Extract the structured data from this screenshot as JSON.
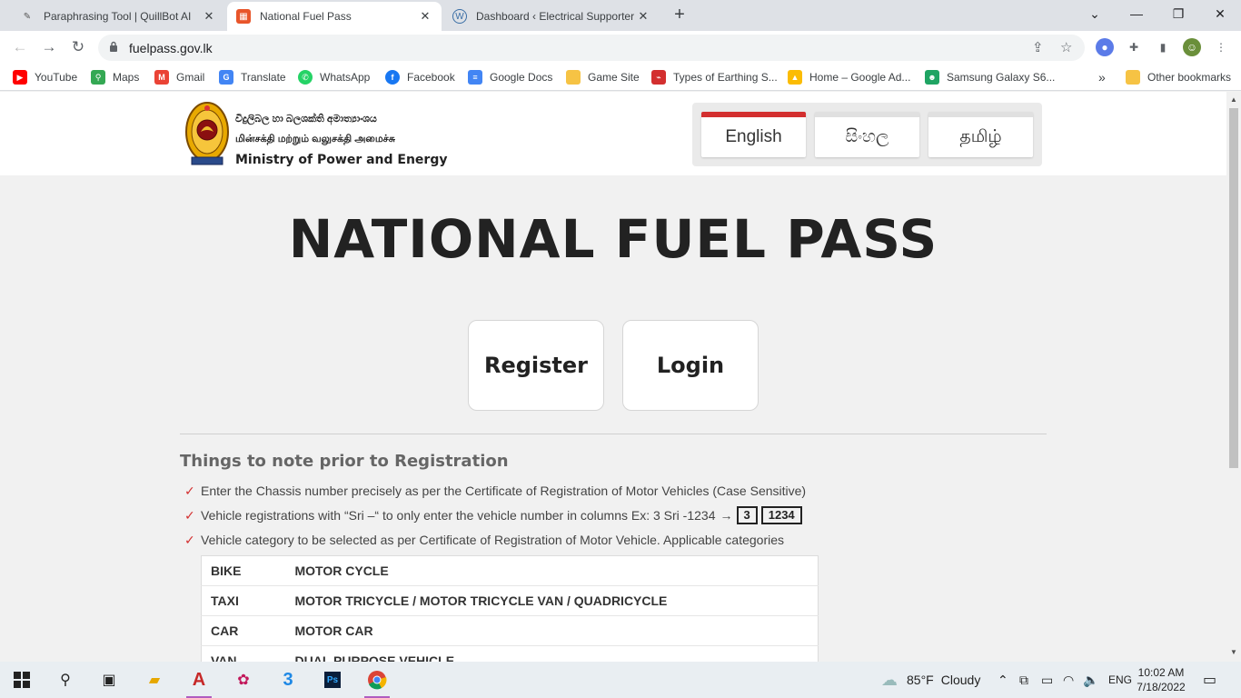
{
  "browser": {
    "tabs": [
      {
        "title": "Paraphrasing Tool | QuillBot AI",
        "icon": "quillbot-icon",
        "active": false
      },
      {
        "title": "National Fuel Pass",
        "icon": "fuelpass-icon",
        "active": true
      },
      {
        "title": "Dashboard ‹ Electrical Supporter",
        "icon": "wordpress-icon",
        "active": false
      }
    ],
    "url": "fuelpass.gov.lk",
    "bookmarks": [
      {
        "label": "YouTube",
        "icon": "youtube-icon",
        "color": "#ff0000"
      },
      {
        "label": "Maps",
        "icon": "maps-icon",
        "color": "#34a853"
      },
      {
        "label": "Gmail",
        "icon": "gmail-icon",
        "color": "#ea4335"
      },
      {
        "label": "Translate",
        "icon": "translate-icon",
        "color": "#4285f4"
      },
      {
        "label": "WhatsApp",
        "icon": "whatsapp-icon",
        "color": "#25d366"
      },
      {
        "label": "Facebook",
        "icon": "facebook-icon",
        "color": "#1877f2"
      },
      {
        "label": "Google Docs",
        "icon": "docs-icon",
        "color": "#4285f4"
      },
      {
        "label": "Game Site",
        "icon": "folder-icon",
        "color": "#f6c344"
      },
      {
        "label": "Types of Earthing S...",
        "icon": "earthing-icon",
        "color": "#d32f2f"
      },
      {
        "label": "Home – Google Ad...",
        "icon": "google-ads-icon",
        "color": "#fbbc04"
      },
      {
        "label": "Samsung Galaxy S6...",
        "icon": "android-icon",
        "color": "#1fa463"
      }
    ],
    "more_bookmarks": "»",
    "other_bookmarks": "Other bookmarks"
  },
  "header": {
    "ministry_sinhala": "විදුලිබල හා බලශක්ති අමාත්‍යාංශය",
    "ministry_tamil": "மின்சக்தி மற்றும் வலுசக்தி அமைச்சு",
    "ministry_english": "Ministry of Power and Energy",
    "languages": [
      {
        "label": "English",
        "active": true
      },
      {
        "label": "සිංහල",
        "active": false
      },
      {
        "label": "தமிழ்",
        "active": false
      }
    ],
    "accent_color": "#d32f2f"
  },
  "main": {
    "title": "NATIONAL FUEL PASS",
    "register_label": "Register",
    "login_label": "Login",
    "notes_title": "Things to note prior to Registration",
    "notes": [
      "Enter the Chassis number precisely as per the Certificate of Registration of Motor Vehicles (Case Sensitive)",
      "Vehicle registrations with “Sri –“ to only enter the vehicle number in columns Ex: 3 Sri -1234",
      "Vehicle category to be selected as per Certificate of Registration of Motor Vehicle. Applicable categories"
    ],
    "example_boxes": [
      "3",
      "1234"
    ],
    "categories": [
      {
        "code": "BIKE",
        "description": "MOTOR CYCLE"
      },
      {
        "code": "TAXI",
        "description": "MOTOR TRICYCLE / MOTOR TRICYCLE VAN / QUADRICYCLE"
      },
      {
        "code": "CAR",
        "description": "MOTOR CAR"
      },
      {
        "code": "VAN",
        "description": "DUAL PURPOSE VEHICLE"
      }
    ]
  },
  "taskbar": {
    "weather_temp": "85°F",
    "weather_text": "Cloudy",
    "language": "ENG",
    "time": "10:02 AM",
    "date": "7/18/2022"
  }
}
